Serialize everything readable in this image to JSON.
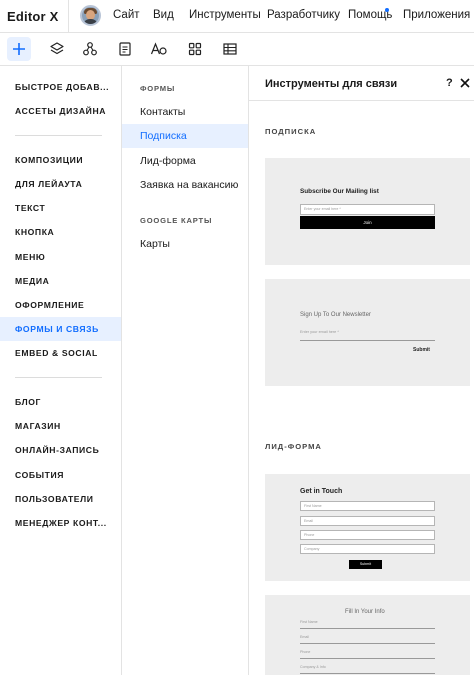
{
  "app": {
    "logo": "Editor X"
  },
  "topbar": {
    "menu": [
      "Сайт",
      "Вид",
      "Инструменты",
      "Разработчику",
      "Помощь",
      "Приложения"
    ]
  },
  "toolbar": {
    "tools": [
      "add-icon",
      "layers-icon",
      "components-icon",
      "pages-icon",
      "typography-icon",
      "apps-grid-icon",
      "cms-table-icon"
    ]
  },
  "categories": {
    "group1": [
      "БЫСТРОЕ ДОБАВ...",
      "АССЕТЫ ДИЗАЙНА"
    ],
    "group2": [
      "КОМПОЗИЦИИ",
      "ДЛЯ ЛЕЙАУТА",
      "ТЕКСТ",
      "КНОПКА",
      "МЕНЮ",
      "МЕДИА",
      "ОФОРМЛЕНИЕ",
      "ФОРМЫ И СВЯЗЬ",
      "EMBED & SOCIAL"
    ],
    "group3": [
      "БЛОГ",
      "МАГАЗИН",
      "ОНЛАЙН-ЗАПИСЬ",
      "СОБЫТИЯ",
      "ПОЛЬЗОВАТЕЛИ",
      "МЕНЕДЖЕР КОНТ..."
    ],
    "active": "ФОРМЫ И СВЯЗЬ"
  },
  "subcategories": {
    "forms_heading": "ФОРМЫ",
    "forms": [
      "Контакты",
      "Подписка",
      "Лид-форма",
      "Заявка на вакансию"
    ],
    "maps_heading": "GOOGLE КАРТЫ",
    "maps": [
      "Карты"
    ],
    "active": "Подписка"
  },
  "panel": {
    "title": "Инструменты для связи",
    "help": "?",
    "section_subscribe": "ПОДПИСКА",
    "section_lead": "ЛИД-ФОРМА"
  },
  "cards": {
    "subscribe1": {
      "title": "Subscribe Our Mailing list",
      "placeholder": "Enter your email here *",
      "button": "Join"
    },
    "subscribe2": {
      "title": "Sign Up To Our Newsletter",
      "placeholder": "Enter your email here *",
      "button": "Submit"
    },
    "lead1": {
      "title": "Get in Touch",
      "fields": [
        "First Name",
        "Email",
        "Phone",
        "Company"
      ],
      "button": "Submit"
    },
    "lead2": {
      "title": "Fill In Your Info",
      "fields": [
        "First Name",
        "Email",
        "Phone",
        "Company & Info"
      ]
    }
  },
  "colors": {
    "accent": "#116dff",
    "active_bg": "#e7f0ff",
    "card_bg": "#ededed"
  }
}
